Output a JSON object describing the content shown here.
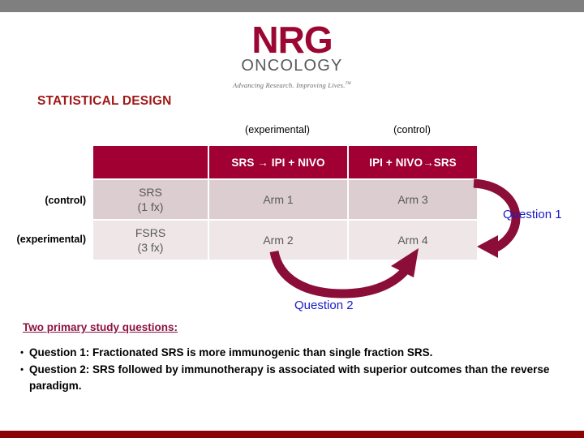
{
  "slide": {
    "title": "STATISTICAL DESIGN",
    "brand": {
      "logo_primary": "NRG",
      "logo_secondary": "ONCOLOGY",
      "tagline": "Advancing Research. Improving Lives.",
      "tagline_mark": "TM"
    },
    "colors": {
      "top_bar": "#7f7f7f",
      "bottom_bar": "#8b0304",
      "title_red": "#a01818",
      "table_header": "#a10033",
      "row_band_1": "#dccdd0",
      "row_band_2": "#eee6e7",
      "question_blue": "#1a1ac8",
      "arrow_maroon": "#8b0e38",
      "logo_maroon": "#9b0632",
      "logo_gray": "#58595b"
    }
  },
  "table": {
    "column_supers": [
      "(experimental)",
      "(control)"
    ],
    "headers": [
      "",
      "SRS → IPI + NIVO",
      "IPI + NIVO→SRS"
    ],
    "row_supers": [
      "(control)",
      "(experimental)"
    ],
    "rows": [
      {
        "label_line1": "SRS",
        "label_line2": "(1 fx)",
        "cells": [
          "Arm 1",
          "Arm 3"
        ]
      },
      {
        "label_line1": "FSRS",
        "label_line2": "(3 fx)",
        "cells": [
          "Arm 2",
          "Arm 4"
        ]
      }
    ]
  },
  "annotations": {
    "question1": "Question 1",
    "question2": "Question 2"
  },
  "footer": {
    "heading": "Two primary study questions:",
    "bullet_marker": "•",
    "bullets": [
      "Question 1: Fractionated SRS is more immunogenic than single fraction SRS.",
      "Question 2: SRS followed by immunotherapy is associated with superior outcomes than the reverse paradigm."
    ]
  }
}
